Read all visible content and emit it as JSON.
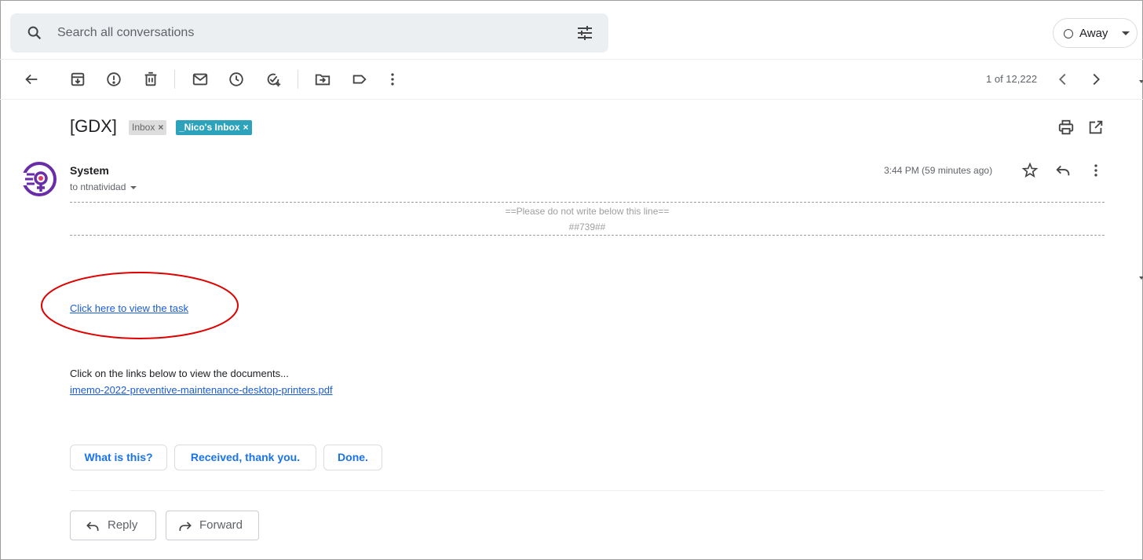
{
  "search": {
    "placeholder": "Search all conversations"
  },
  "status": {
    "label": "Away"
  },
  "pager": {
    "text": "1 of 12,222"
  },
  "message": {
    "subject": "[GDX]",
    "labels": [
      {
        "text": "Inbox",
        "remove": "×"
      },
      {
        "text": "_Nico's Inbox",
        "remove": "×"
      }
    ],
    "sender": "System",
    "recipient": "to ntnatividad",
    "time": "3:44 PM (59 minutes ago)",
    "notice_line1": "==Please do not write below this line==",
    "notice_line2": "##739##",
    "task_link": "Click here to view the task",
    "body_text": "Click on the links below to view the documents...",
    "doc_link": "imemo-2022-preventive-maintenance-desktop-printers.pdf"
  },
  "smart_replies": [
    "What is this?",
    "Received, thank you.",
    "Done."
  ],
  "actions": {
    "reply": "Reply",
    "forward": "Forward"
  },
  "colors": {
    "accent": "#1a73e8",
    "label_teal": "#2da2bb",
    "annotation_red": "#e00000"
  },
  "icons": [
    "search-icon",
    "tune-icon",
    "back-arrow-icon",
    "archive-icon",
    "report-spam-icon",
    "delete-icon",
    "mark-unread-icon",
    "snooze-icon",
    "add-task-icon",
    "move-to-icon",
    "label-icon",
    "more-vert-icon",
    "chevron-left-icon",
    "chevron-right-icon",
    "print-icon",
    "open-new-window-icon",
    "star-icon",
    "reply-icon"
  ]
}
